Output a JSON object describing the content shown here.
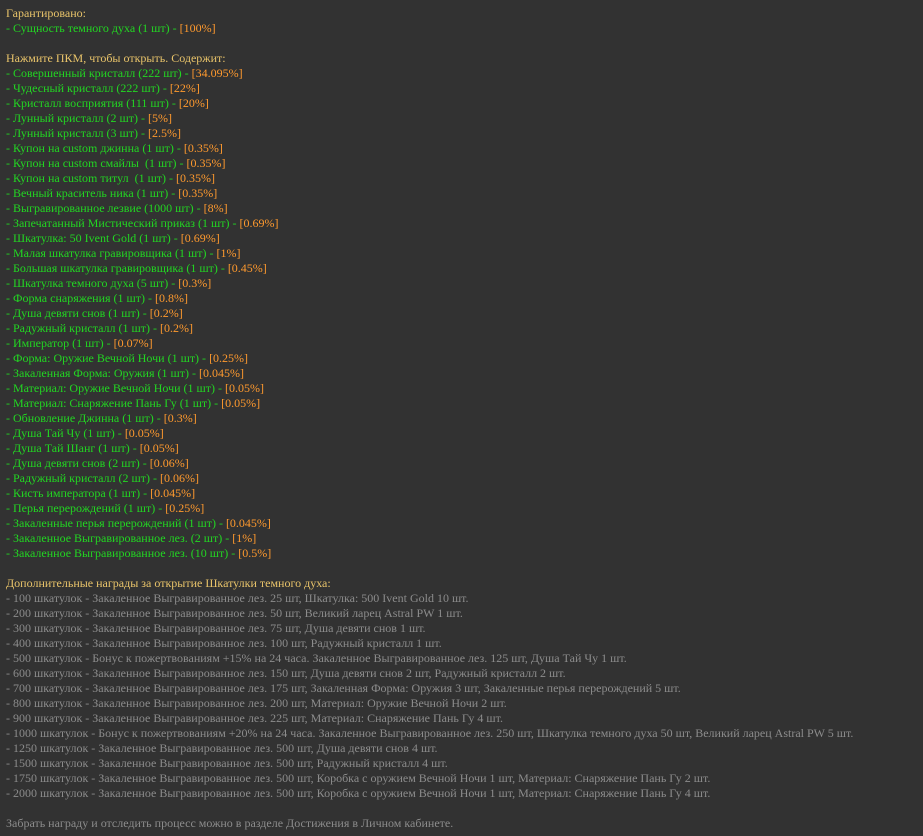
{
  "guaranteed": {
    "header": "Гарантировано:",
    "items": [
      {
        "name": "- Сущность темного духа (1 шт) - ",
        "pct": "[100%]"
      }
    ]
  },
  "contents": {
    "header": "Нажмите ПКМ, чтобы открыть. Содержит:",
    "items": [
      {
        "name": "- Совершенный кристалл (222 шт) - ",
        "pct": "[34.095%]"
      },
      {
        "name": "- Чудесный кристалл (222 шт) - ",
        "pct": "[22%]"
      },
      {
        "name": "- Кристалл восприятия (111 шт) - ",
        "pct": "[20%]"
      },
      {
        "name": "- Лунный кристалл (2 шт) - ",
        "pct": "[5%]"
      },
      {
        "name": "- Лунный кристалл (3 шт) - ",
        "pct": "[2.5%]"
      },
      {
        "name": "- Купон на custom джинна (1 шт) - ",
        "pct": "[0.35%]"
      },
      {
        "name": "- Купон на custom смайлы  (1 шт) - ",
        "pct": "[0.35%]"
      },
      {
        "name": "- Купон на custom титул  (1 шт) - ",
        "pct": "[0.35%]"
      },
      {
        "name": "- Вечный краситель ника (1 шт) - ",
        "pct": "[0.35%]"
      },
      {
        "name": "- Выгравированное лезвие (1000 шт) - ",
        "pct": "[8%]"
      },
      {
        "name": "- Запечатанный Мистический приказ (1 шт) - ",
        "pct": "[0.69%]"
      },
      {
        "name": "- Шкатулка: 50 Ivent Gold (1 шт) - ",
        "pct": "[0.69%]"
      },
      {
        "name": "- Малая шкатулка гравировщика (1 шт) - ",
        "pct": "[1%]"
      },
      {
        "name": "- Большая шкатулка гравировщика (1 шт) - ",
        "pct": "[0.45%]"
      },
      {
        "name": "- Шкатулка темного духа (5 шт) - ",
        "pct": "[0.3%]"
      },
      {
        "name": "- Форма снаряжения (1 шт) - ",
        "pct": "[0.8%]"
      },
      {
        "name": "- Душа девяти снов (1 шт) - ",
        "pct": "[0.2%]"
      },
      {
        "name": "- Радужный кристалл (1 шт) - ",
        "pct": "[0.2%]"
      },
      {
        "name": "- Император (1 шт) - ",
        "pct": "[0.07%]"
      },
      {
        "name": "- Форма: Оружие Вечной Ночи (1 шт) - ",
        "pct": "[0.25%]"
      },
      {
        "name": "- Закаленная Форма: Оружия (1 шт) - ",
        "pct": "[0.045%]"
      },
      {
        "name": "- Материал: Оружие Вечной Ночи (1 шт) - ",
        "pct": "[0.05%]"
      },
      {
        "name": "- Материал: Снаряжение Пань Гу (1 шт) - ",
        "pct": "[0.05%]"
      },
      {
        "name": "- Обновление Джинна (1 шт) - ",
        "pct": "[0.3%]"
      },
      {
        "name": "- Душа Тай Чу (1 шт) - ",
        "pct": "[0.05%]"
      },
      {
        "name": "- Душа Тай Шанг (1 шт) - ",
        "pct": "[0.05%]"
      },
      {
        "name": "- Душа девяти снов (2 шт) - ",
        "pct": "[0.06%]"
      },
      {
        "name": "- Радужный кристалл (2 шт) - ",
        "pct": "[0.06%]"
      },
      {
        "name": "- Кисть императора (1 шт) - ",
        "pct": "[0.045%]"
      },
      {
        "name": "- Перья перерождений (1 шт) - ",
        "pct": "[0.25%]"
      },
      {
        "name": "- Закаленные перья перерождений (1 шт) - ",
        "pct": "[0.045%]"
      },
      {
        "name": "- Закаленное Выгравированное лез. (2 шт) - ",
        "pct": "[1%]"
      },
      {
        "name": "- Закаленное Выгравированное лез. (10 шт) - ",
        "pct": "[0.5%]"
      }
    ]
  },
  "bonus": {
    "header": "Дополнительные награды за открытие Шкатулки темного духа:",
    "items": [
      "- 100 шкатулок - Закаленное Выгравированное лез. 25 шт, Шкатулка: 500 Ivent Gold 10 шт.",
      "- 200 шкатулок - Закаленное Выгравированное лез. 50 шт, Великий ларец Astral PW 1 шт.",
      "- 300 шкатулок - Закаленное Выгравированное лез. 75 шт, Душа девяти снов 1 шт.",
      "- 400 шкатулок - Закаленное Выгравированное лез. 100 шт, Радужный кристалл 1 шт.",
      "- 500 шкатулок - Бонус к пожертвованиям +15% на 24 часа. Закаленное Выгравированное лез. 125 шт, Душа Тай Чу 1 шт.",
      "- 600 шкатулок - Закаленное Выгравированное лез. 150 шт, Душа девяти снов 2 шт, Радужный кристалл 2 шт.",
      "- 700 шкатулок - Закаленное Выгравированное лез. 175 шт, Закаленная Форма: Оружия 3 шт, Закаленные перья перерождений 5 шт.",
      "- 800 шкатулок - Закаленное Выгравированное лез. 200 шт, Материал: Оружие Вечной Ночи 2 шт.",
      "- 900 шкатулок - Закаленное Выгравированное лез. 225 шт, Материал: Снаряжение Пань Гу 4 шт.",
      "- 1000 шкатулок - Бонус к пожертвованиям +20% на 24 часа. Закаленное Выгравированное лез. 250 шт, Шкатулка темного духа 50 шт, Великий ларец Astral PW 5 шт.",
      "- 1250 шкатулок - Закаленное Выгравированное лез. 500 шт, Душа девяти снов 4 шт.",
      "- 1500 шкатулок - Закаленное Выгравированное лез. 500 шт, Радужный кристалл 4 шт.",
      "- 1750 шкатулок - Закаленное Выгравированное лез. 500 шт, Коробка с оружием Вечной Ночи 1 шт, Материал: Снаряжение Пань Гу 2 шт.",
      "- 2000 шкатулок - Закаленное Выгравированное лез. 500 шт, Коробка с оружием Вечной Ночи 1 шт, Материал: Снаряжение Пань Гу 4 шт."
    ]
  },
  "footer": "Забрать награду и отследить процесс можно в разделе Достижения в Личном кабинете.",
  "colors": {
    "background": "#323232",
    "header": "#e9c46a",
    "item": "#22d622",
    "percent": "#ff9a2e",
    "muted": "#8c8c8c"
  }
}
